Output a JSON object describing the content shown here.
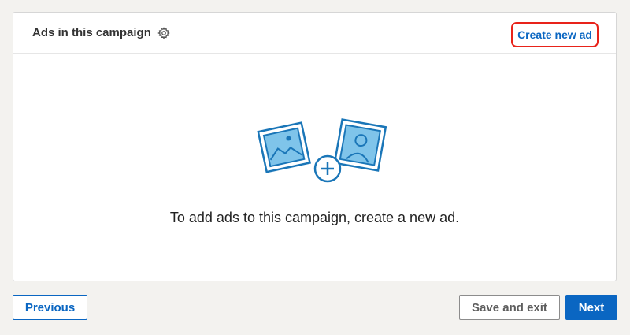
{
  "card": {
    "title": "Ads in this campaign",
    "settings_icon": "gear-icon",
    "create_link": "Create new ad",
    "empty_message": "To add ads to this campaign, create a new ad.",
    "illustration_icons": [
      "image-placeholder-icon",
      "add-circle-icon",
      "profile-placeholder-icon"
    ]
  },
  "footer": {
    "previous_label": "Previous",
    "save_exit_label": "Save and exit",
    "next_label": "Next"
  },
  "colors": {
    "accent": "#0a66c2",
    "highlight_border": "#e8231a",
    "illustration_fill": "#7fc4ea",
    "background": "#f3f2ef"
  }
}
